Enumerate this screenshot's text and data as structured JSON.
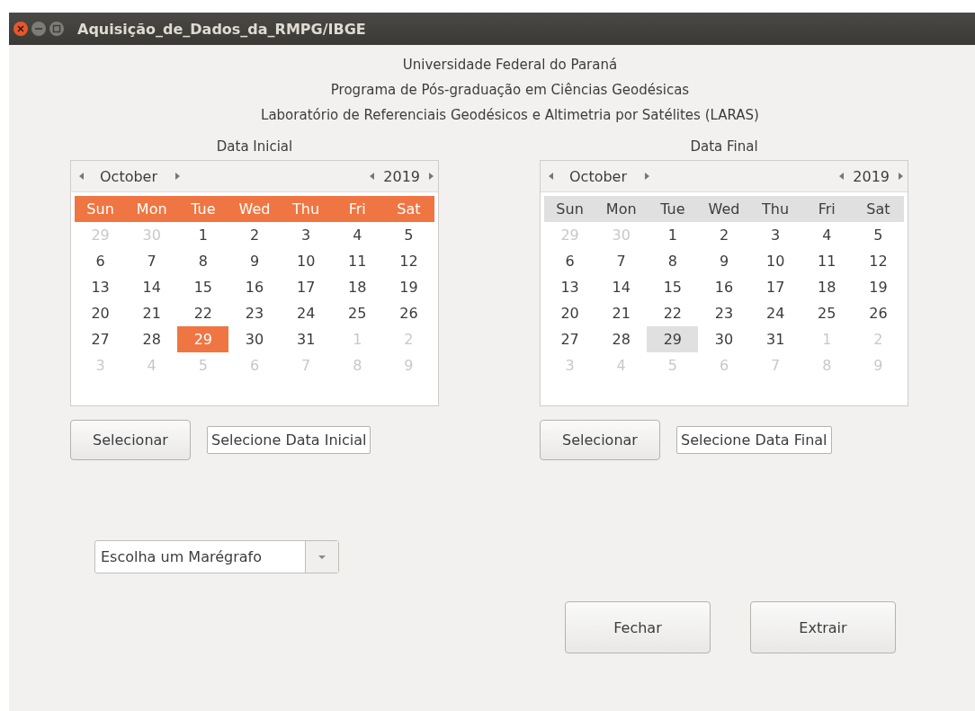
{
  "window": {
    "title": "Aquisição_de_Dados_da_RMPG/IBGE"
  },
  "header": [
    "Universidade Federal do Paraná",
    "Programa de Pós-graduação em Ciências Geodésicas",
    "Laboratório de Referenciais Geodésicos e Altimetria por Satélites (LARAS)"
  ],
  "calendars": [
    {
      "label": "Data Inicial",
      "focused": true,
      "month": "October",
      "year": "2019",
      "weekdays": [
        "Sun",
        "Mon",
        "Tue",
        "Wed",
        "Thu",
        "Fri",
        "Sat"
      ],
      "weeks": [
        [
          {
            "day": "29",
            "in_month": false,
            "selected": false
          },
          {
            "day": "30",
            "in_month": false,
            "selected": false
          },
          {
            "day": "1",
            "in_month": true,
            "selected": false
          },
          {
            "day": "2",
            "in_month": true,
            "selected": false
          },
          {
            "day": "3",
            "in_month": true,
            "selected": false
          },
          {
            "day": "4",
            "in_month": true,
            "selected": false
          },
          {
            "day": "5",
            "in_month": true,
            "selected": false
          }
        ],
        [
          {
            "day": "6",
            "in_month": true,
            "selected": false
          },
          {
            "day": "7",
            "in_month": true,
            "selected": false
          },
          {
            "day": "8",
            "in_month": true,
            "selected": false
          },
          {
            "day": "9",
            "in_month": true,
            "selected": false
          },
          {
            "day": "10",
            "in_month": true,
            "selected": false
          },
          {
            "day": "11",
            "in_month": true,
            "selected": false
          },
          {
            "day": "12",
            "in_month": true,
            "selected": false
          }
        ],
        [
          {
            "day": "13",
            "in_month": true,
            "selected": false
          },
          {
            "day": "14",
            "in_month": true,
            "selected": false
          },
          {
            "day": "15",
            "in_month": true,
            "selected": false
          },
          {
            "day": "16",
            "in_month": true,
            "selected": false
          },
          {
            "day": "17",
            "in_month": true,
            "selected": false
          },
          {
            "day": "18",
            "in_month": true,
            "selected": false
          },
          {
            "day": "19",
            "in_month": true,
            "selected": false
          }
        ],
        [
          {
            "day": "20",
            "in_month": true,
            "selected": false
          },
          {
            "day": "21",
            "in_month": true,
            "selected": false
          },
          {
            "day": "22",
            "in_month": true,
            "selected": false
          },
          {
            "day": "23",
            "in_month": true,
            "selected": false
          },
          {
            "day": "24",
            "in_month": true,
            "selected": false
          },
          {
            "day": "25",
            "in_month": true,
            "selected": false
          },
          {
            "day": "26",
            "in_month": true,
            "selected": false
          }
        ],
        [
          {
            "day": "27",
            "in_month": true,
            "selected": false
          },
          {
            "day": "28",
            "in_month": true,
            "selected": false
          },
          {
            "day": "29",
            "in_month": true,
            "selected": true
          },
          {
            "day": "30",
            "in_month": true,
            "selected": false
          },
          {
            "day": "31",
            "in_month": true,
            "selected": false
          },
          {
            "day": "1",
            "in_month": false,
            "selected": false
          },
          {
            "day": "2",
            "in_month": false,
            "selected": false
          }
        ],
        [
          {
            "day": "3",
            "in_month": false,
            "selected": false
          },
          {
            "day": "4",
            "in_month": false,
            "selected": false
          },
          {
            "day": "5",
            "in_month": false,
            "selected": false
          },
          {
            "day": "6",
            "in_month": false,
            "selected": false
          },
          {
            "day": "7",
            "in_month": false,
            "selected": false
          },
          {
            "day": "8",
            "in_month": false,
            "selected": false
          },
          {
            "day": "9",
            "in_month": false,
            "selected": false
          }
        ]
      ],
      "button": "Selecionar",
      "display": "Selecione Data Inicial"
    },
    {
      "label": "Data Final",
      "focused": false,
      "month": "October",
      "year": "2019",
      "weekdays": [
        "Sun",
        "Mon",
        "Tue",
        "Wed",
        "Thu",
        "Fri",
        "Sat"
      ],
      "weeks": [
        [
          {
            "day": "29",
            "in_month": false,
            "selected": false
          },
          {
            "day": "30",
            "in_month": false,
            "selected": false
          },
          {
            "day": "1",
            "in_month": true,
            "selected": false
          },
          {
            "day": "2",
            "in_month": true,
            "selected": false
          },
          {
            "day": "3",
            "in_month": true,
            "selected": false
          },
          {
            "day": "4",
            "in_month": true,
            "selected": false
          },
          {
            "day": "5",
            "in_month": true,
            "selected": false
          }
        ],
        [
          {
            "day": "6",
            "in_month": true,
            "selected": false
          },
          {
            "day": "7",
            "in_month": true,
            "selected": false
          },
          {
            "day": "8",
            "in_month": true,
            "selected": false
          },
          {
            "day": "9",
            "in_month": true,
            "selected": false
          },
          {
            "day": "10",
            "in_month": true,
            "selected": false
          },
          {
            "day": "11",
            "in_month": true,
            "selected": false
          },
          {
            "day": "12",
            "in_month": true,
            "selected": false
          }
        ],
        [
          {
            "day": "13",
            "in_month": true,
            "selected": false
          },
          {
            "day": "14",
            "in_month": true,
            "selected": false
          },
          {
            "day": "15",
            "in_month": true,
            "selected": false
          },
          {
            "day": "16",
            "in_month": true,
            "selected": false
          },
          {
            "day": "17",
            "in_month": true,
            "selected": false
          },
          {
            "day": "18",
            "in_month": true,
            "selected": false
          },
          {
            "day": "19",
            "in_month": true,
            "selected": false
          }
        ],
        [
          {
            "day": "20",
            "in_month": true,
            "selected": false
          },
          {
            "day": "21",
            "in_month": true,
            "selected": false
          },
          {
            "day": "22",
            "in_month": true,
            "selected": false
          },
          {
            "day": "23",
            "in_month": true,
            "selected": false
          },
          {
            "day": "24",
            "in_month": true,
            "selected": false
          },
          {
            "day": "25",
            "in_month": true,
            "selected": false
          },
          {
            "day": "26",
            "in_month": true,
            "selected": false
          }
        ],
        [
          {
            "day": "27",
            "in_month": true,
            "selected": false
          },
          {
            "day": "28",
            "in_month": true,
            "selected": false
          },
          {
            "day": "29",
            "in_month": true,
            "selected": true
          },
          {
            "day": "30",
            "in_month": true,
            "selected": false
          },
          {
            "day": "31",
            "in_month": true,
            "selected": false
          },
          {
            "day": "1",
            "in_month": false,
            "selected": false
          },
          {
            "day": "2",
            "in_month": false,
            "selected": false
          }
        ],
        [
          {
            "day": "3",
            "in_month": false,
            "selected": false
          },
          {
            "day": "4",
            "in_month": false,
            "selected": false
          },
          {
            "day": "5",
            "in_month": false,
            "selected": false
          },
          {
            "day": "6",
            "in_month": false,
            "selected": false
          },
          {
            "day": "7",
            "in_month": false,
            "selected": false
          },
          {
            "day": "8",
            "in_month": false,
            "selected": false
          },
          {
            "day": "9",
            "in_month": false,
            "selected": false
          }
        ]
      ],
      "button": "Selecionar",
      "display": "Selecione Data Final"
    }
  ],
  "tide_gauge_combo": {
    "value": "Escolha um Marégrafo"
  },
  "buttons": [
    "Fechar",
    "Extrair"
  ]
}
